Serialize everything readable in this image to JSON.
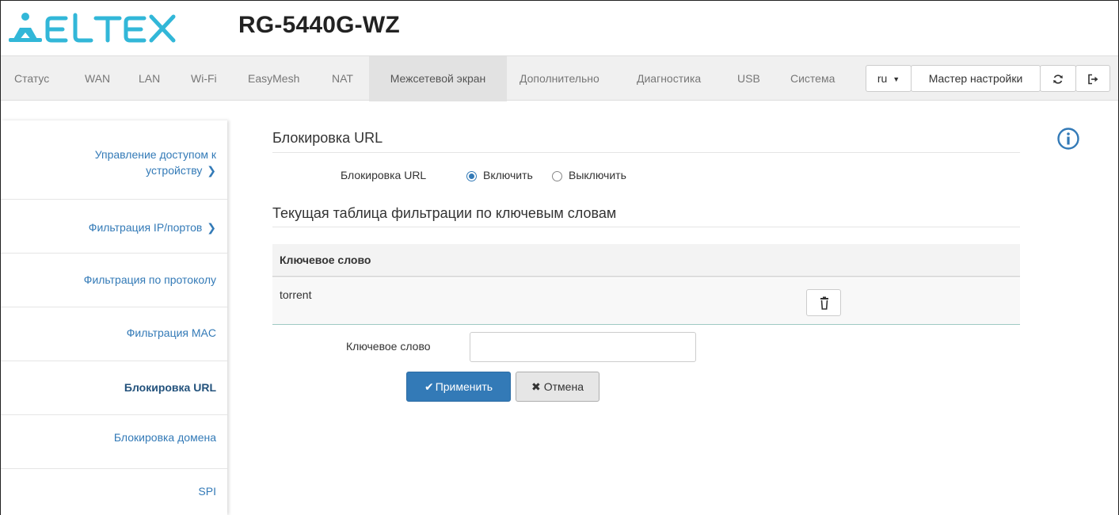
{
  "header": {
    "brand": "ELTEX",
    "model": "RG-5440G-WZ",
    "accent_color": "#32b7d8"
  },
  "nav": {
    "items": [
      {
        "label": "Статус",
        "active": false
      },
      {
        "label": "WAN",
        "active": false
      },
      {
        "label": "LAN",
        "active": false
      },
      {
        "label": "Wi-Fi",
        "active": false
      },
      {
        "label": "EasyMesh",
        "active": false
      },
      {
        "label": "NAT",
        "active": false
      },
      {
        "label": "Межсетевой экран",
        "active": true
      },
      {
        "label": "Дополнительно",
        "active": false
      },
      {
        "label": "Диагностика",
        "active": false
      },
      {
        "label": "USB",
        "active": false
      },
      {
        "label": "Система",
        "active": false
      }
    ],
    "language": "ru",
    "wizard_label": "Мастер настройки",
    "refresh_icon": "refresh-icon",
    "logout_icon": "logout-icon"
  },
  "sidebar": {
    "items": [
      {
        "label_line1": "Управление доступом к",
        "label_line2": "устройству",
        "chevron": "❯",
        "active": false
      },
      {
        "label": "Фильтрация IP/портов",
        "chevron": "❯",
        "active": false
      },
      {
        "label": "Фильтрация по протоколу",
        "active": false
      },
      {
        "label": "Фильтрация MAC",
        "active": false
      },
      {
        "label": "Блокировка URL",
        "active": true
      },
      {
        "label": "Блокировка домена",
        "active": false
      },
      {
        "label": "SPI",
        "active": false
      }
    ]
  },
  "main": {
    "section_title": "Блокировка URL",
    "toggle": {
      "label": "Блокировка URL",
      "on_label": "Включить",
      "off_label": "Выключить",
      "selected": "on"
    },
    "table_title": "Текущая таблица фильтрации по ключевым словам",
    "table": {
      "header": "Ключевое слово",
      "rows": [
        {
          "keyword": "torrent"
        }
      ]
    },
    "keyword_field": {
      "label": "Ключевое слово",
      "value": "",
      "placeholder": ""
    },
    "apply_label": "Применить",
    "cancel_label": "Отмена"
  }
}
